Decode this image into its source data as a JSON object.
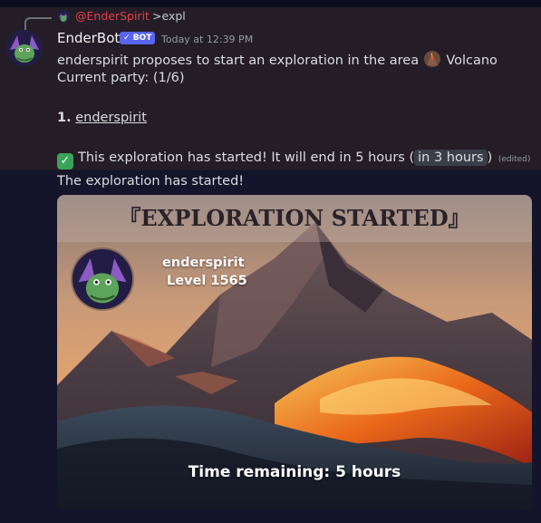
{
  "reply": {
    "username": "@EnderSpirit",
    "command": ">expl"
  },
  "message": {
    "author": "EnderBot",
    "bot_badge": "BOT",
    "timestamp": "Today at 12:39 PM",
    "line1_prefix": "enderspirit proposes to start an exploration in the area",
    "area_name": "Volcano",
    "party": "Current party: (1/6)",
    "member_number": "1.",
    "member_name": "enderspirit",
    "started_text": "This exploration has started! It will end in 5 hours (",
    "relative_time": "in 3 hours",
    "started_close": ")",
    "edited": "(edited)",
    "followup": "The exploration has started!"
  },
  "embed": {
    "title": "『EXPLORATION STARTED』",
    "username": "enderspirit",
    "level": "Level 1565",
    "time_remaining": "Time remaining: 5 hours"
  },
  "colors": {
    "background": "#14142a",
    "message_highlight": "#241c26",
    "mention": "#e0414b",
    "bot_badge": "#5865f2"
  },
  "icons": {
    "avatar": "purple-dragon-avatar",
    "area_emoji": "volcano-emoji",
    "check_emoji": "check-mark-button-emoji"
  }
}
